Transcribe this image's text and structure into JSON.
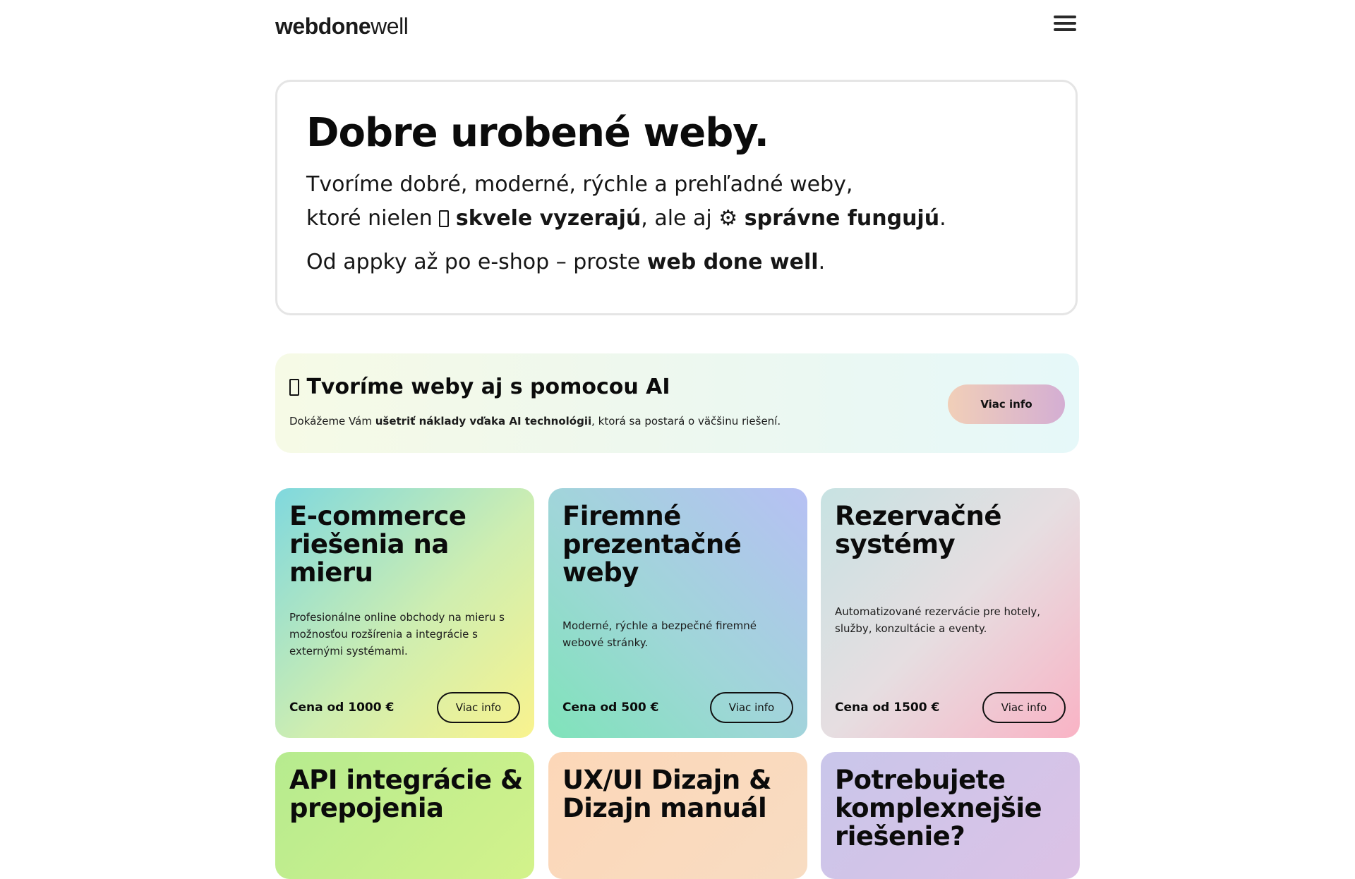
{
  "header": {
    "logo_part1": "web",
    "logo_part2": "done",
    "logo_part3": "well",
    "menu_icon": "hamburger-menu-icon"
  },
  "hero": {
    "title": "Dobre urobené weby.",
    "line1": "Tvoríme dobré, moderné, rýchle a prehľadné weby,",
    "line2_pre": "ktoré nielen ",
    "line2_bold1": "skvele vyzerajú",
    "line2_mid": ", ale aj ",
    "line2_gear": "⚙",
    "line2_bold2": "správne fungujú",
    "line2_end": ".",
    "line3_pre": "Od appky až po e-shop – proste ",
    "line3_bold": "web done well",
    "line3_end": "."
  },
  "ai_banner": {
    "title": "Tvoríme weby aj s pomocou AI",
    "desc_pre": "Dokážeme Vám ",
    "desc_bold": "ušetriť náklady vďaka AI technológii",
    "desc_end": ", ktorá sa postará o väčšinu riešení.",
    "button": "Viac info"
  },
  "cards": [
    {
      "title_l1": "E-commerce",
      "title_l2": "riešenia na",
      "title_l3": "mieru",
      "desc": "Profesionálne online obchody na mieru s možnosťou rozšírenia a integrácie s externými systémami.",
      "price": "Cena od 1000 €",
      "button": "Viac info"
    },
    {
      "title_l1": "Firemné",
      "title_l2": "prezentačné",
      "title_l3": "weby",
      "desc": "Moderné, rýchle a bezpečné firemné webové stránky.",
      "price": "Cena od 500 €",
      "button": "Viac info"
    },
    {
      "title_l1": "Rezervačné",
      "title_l2": "systémy",
      "desc": "Automatizované rezervácie pre hotely, služby, konzultácie a eventy.",
      "price": "Cena od 1500 €",
      "button": "Viac info"
    },
    {
      "title_l1": "API integrácie &",
      "title_l2": "prepojenia"
    },
    {
      "title_l1": "UX/UI Dizajn &",
      "title_l2": "Dizajn manuál"
    },
    {
      "title_l1": "Potrebujete",
      "title_l2": "komplexnejšie",
      "title_l3": "riešenie?"
    }
  ]
}
